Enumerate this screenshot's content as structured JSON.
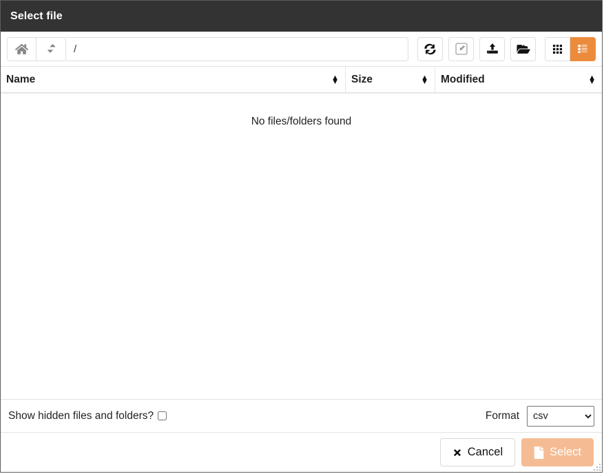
{
  "dialog": {
    "title": "Select file"
  },
  "toolbar": {
    "home_label": "home-icon",
    "up_label": "level-up-icon",
    "path_value": "/",
    "path_placeholder": "/",
    "refresh_label": "refresh-icon",
    "rename_label": "edit-icon",
    "upload_label": "upload-icon",
    "new_folder_label": "new-folder-icon",
    "grid_view_label": "grid-view-icon",
    "list_view_label": "list-view-icon",
    "active_view": "list",
    "accent_color": "#ec8b3c"
  },
  "table": {
    "columns": [
      {
        "key": "name",
        "label": "Name",
        "sortable": true
      },
      {
        "key": "size",
        "label": "Size",
        "sortable": true
      },
      {
        "key": "modified",
        "label": "Modified",
        "sortable": true
      }
    ],
    "rows": [],
    "empty_message": "No files/folders found"
  },
  "options": {
    "hidden_files_label": "Show hidden files and folders?",
    "hidden_files_checked": false,
    "format_label": "Format",
    "format_value": "csv",
    "format_options": [
      "csv"
    ]
  },
  "footer": {
    "cancel_label": "Cancel",
    "select_label": "Select",
    "select_disabled": true
  }
}
